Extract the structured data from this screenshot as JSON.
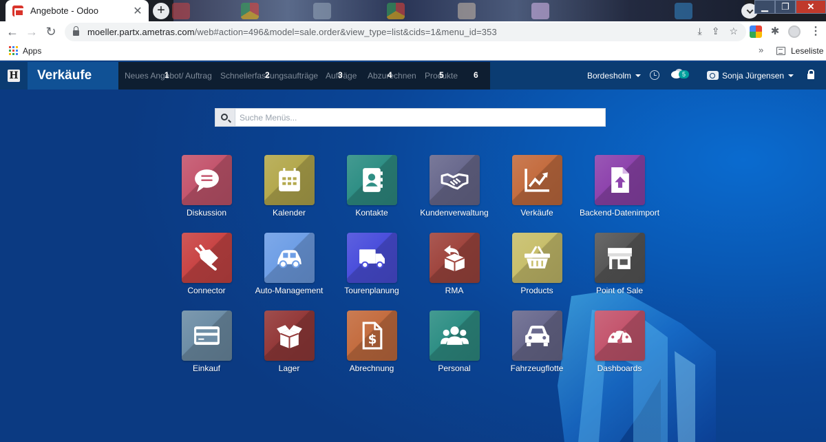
{
  "browser": {
    "tab_title": "Angebote - Odoo",
    "tab_close": "✕",
    "new_tab": "+",
    "url_host": "moeller.partx.ametras.com",
    "url_path": "/web#action=496&model=sale.order&view_type=list&cids=1&menu_id=353",
    "bookmarks_apps": "Apps",
    "bookmarks_more": "»",
    "reading_list": "Leseliste"
  },
  "odoo": {
    "app_name": "Verkäufe",
    "home_letter": "H",
    "menu": [
      {
        "label": "Neues Angebot/ Auftrag",
        "num": "1"
      },
      {
        "label": "Schnellerfassungsaufträge",
        "num": "2"
      },
      {
        "label": "Aufträge",
        "num": "3"
      },
      {
        "label": "Abzurechnen",
        "num": "4"
      },
      {
        "label": "Produkte",
        "num": "5"
      },
      {
        "label": "",
        "num": "6"
      }
    ],
    "company": "Bordesholm",
    "chat_count": "5",
    "user": "Sonja Jürgensen"
  },
  "search": {
    "placeholder": "Suche Menüs..."
  },
  "apps": [
    {
      "label": "Diskussion",
      "color": "#c4566e",
      "icon": "chat-icon"
    },
    {
      "label": "Kalender",
      "color": "#b4a94e",
      "icon": "calendar-icon"
    },
    {
      "label": "Kontakte",
      "color": "#2f8f85",
      "icon": "address-book-icon"
    },
    {
      "label": "Kundenverwaltung",
      "color": "#6a6a8e",
      "icon": "handshake-icon"
    },
    {
      "label": "Verkäufe",
      "color": "#c46d40",
      "icon": "chart-line-icon"
    },
    {
      "label": "Backend-Datenimport",
      "color": "#8e44ad",
      "icon": "file-upload-icon"
    },
    {
      "label": "Connector",
      "color": "#c94545",
      "icon": "plug-icon"
    },
    {
      "label": "Auto-Management",
      "color": "#6f9fe6",
      "icon": "car-icon"
    },
    {
      "label": "Tourenplanung",
      "color": "#4b4fdc",
      "icon": "truck-icon"
    },
    {
      "label": "RMA",
      "color": "#a0463f",
      "icon": "box-return-icon"
    },
    {
      "label": "Products",
      "color": "#c8bf6c",
      "icon": "basket-icon"
    },
    {
      "label": "Point of Sale",
      "color": "#585858",
      "icon": "store-icon"
    },
    {
      "label": "Einkauf",
      "color": "#6e8ea6",
      "icon": "credit-card-icon"
    },
    {
      "label": "Lager",
      "color": "#943a3a",
      "icon": "open-box-icon"
    },
    {
      "label": "Abrechnung",
      "color": "#c46d40",
      "icon": "invoice-dollar-icon"
    },
    {
      "label": "Personal",
      "color": "#2f8f85",
      "icon": "users-icon"
    },
    {
      "label": "Fahrzeugflotte",
      "color": "#6a6a8e",
      "icon": "car-front-icon"
    },
    {
      "label": "Dashboards",
      "color": "#c4566e",
      "icon": "gauge-icon"
    }
  ]
}
